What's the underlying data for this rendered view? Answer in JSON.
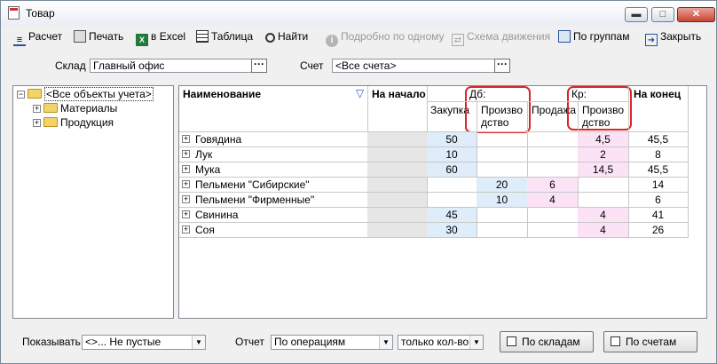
{
  "window": {
    "title": "Товар"
  },
  "toolbar": {
    "calc": "Расчет",
    "print": "Печать",
    "excel": "в Excel",
    "table": "Таблица",
    "find": "Найти",
    "detail": "Подробно по одному",
    "scheme": "Схема движения",
    "groups": "По группам",
    "close": "Закрыть"
  },
  "filters": {
    "warehouse_label": "Склад",
    "warehouse_value": "Главный офис",
    "account_label": "Счет",
    "account_value": "<Все счета>"
  },
  "tree": {
    "root": "<Все объекты учета>",
    "children": [
      "Материалы",
      "Продукция"
    ]
  },
  "grid": {
    "headers": {
      "name": "Наименование",
      "start": "На начало",
      "debit": "Дб:",
      "credit": "Кр:",
      "purchase": "Закупка",
      "production_line1": "Произво",
      "production_line2": "дство",
      "sale": "Продажа",
      "credit_production_line1": "Произво",
      "credit_production_line2": "дство",
      "end": "На конец"
    },
    "rows": [
      {
        "name": "Говядина",
        "purchase": "50",
        "production": "",
        "sale": "",
        "credit_production": "4,5",
        "end": "45,5"
      },
      {
        "name": "Лук",
        "purchase": "10",
        "production": "",
        "sale": "",
        "credit_production": "2",
        "end": "8"
      },
      {
        "name": "Мука",
        "purchase": "60",
        "production": "",
        "sale": "",
        "credit_production": "14,5",
        "end": "45,5"
      },
      {
        "name": "Пельмени \"Сибирские\"",
        "purchase": "",
        "production": "20",
        "sale": "6",
        "credit_production": "",
        "end": "14"
      },
      {
        "name": "Пельмени \"Фирменные\"",
        "purchase": "",
        "production": "10",
        "sale": "4",
        "credit_production": "",
        "end": "6"
      },
      {
        "name": "Свинина",
        "purchase": "45",
        "production": "",
        "sale": "",
        "credit_production": "4",
        "end": "41"
      },
      {
        "name": "Соя",
        "purchase": "30",
        "production": "",
        "sale": "",
        "credit_production": "4",
        "end": "26"
      }
    ]
  },
  "bottom": {
    "show_label": "Показывать",
    "show_value": "<>...    Не пустые",
    "report_label": "Отчет",
    "report_value": "По операциям",
    "qty_value": "только кол-во",
    "by_warehouses": "По складам",
    "by_accounts": "По счетам"
  }
}
